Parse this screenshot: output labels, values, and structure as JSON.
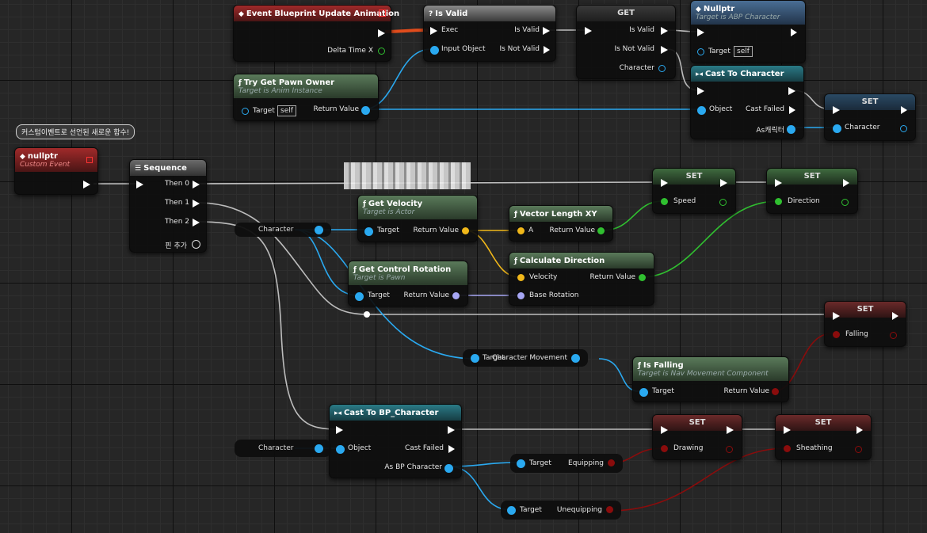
{
  "colors": {
    "exec": "#ffffff",
    "object": "#2aa9f0",
    "float": "#30c030",
    "vector": "#f1b81a",
    "rotator": "#a6a6f4",
    "bool": "#8a0c0c",
    "event": "#a02a2a",
    "pure": "#5a7a5a",
    "cast": "#2a7a86"
  },
  "nodes": {
    "event_update": {
      "title": "Event Blueprint Update Animation",
      "delta": "Delta Time X"
    },
    "is_valid": {
      "title": "Is Valid",
      "exec": "Exec",
      "input": "Input Object",
      "is_valid": "Is Valid",
      "not_valid": "Is Not Valid"
    },
    "get": {
      "title": "GET",
      "is_valid": "Is Valid",
      "not_valid": "Is Not Valid",
      "character": "Character"
    },
    "nullptr_top": {
      "title": "Nullptr",
      "subtitle": "Target is ABP Character",
      "target": "Target",
      "target_val": "self"
    },
    "try_get_pawn": {
      "title": "Try Get Pawn Owner",
      "subtitle": "Target is Anim Instance",
      "target": "Target",
      "target_val": "self",
      "ret": "Return Value"
    },
    "cast_character": {
      "title": "Cast To Character",
      "object": "Object",
      "failed": "Cast Failed",
      "as": "As캐릭터"
    },
    "set_character": {
      "title": "SET",
      "character": "Character"
    },
    "comment": {
      "text": "커스텀이벤트로 선언된 새로운 함수!"
    },
    "custom_event": {
      "title": "nullptr",
      "subtitle": "Custom Event"
    },
    "sequence": {
      "title": "Sequence",
      "then0": "Then 0",
      "then1": "Then 1",
      "then2": "Then 2",
      "add": "핀 추가"
    },
    "char_ref1": {
      "label": "Character"
    },
    "get_velocity": {
      "title": "Get Velocity",
      "subtitle": "Target is Actor",
      "target": "Target",
      "ret": "Return Value"
    },
    "vector_length": {
      "title": "Vector Length XY",
      "a": "A",
      "ret": "Return Value"
    },
    "set_speed": {
      "title": "SET",
      "speed": "Speed"
    },
    "set_direction": {
      "title": "SET",
      "direction": "Direction"
    },
    "get_control_rot": {
      "title": "Get Control Rotation",
      "subtitle": "Target is Pawn",
      "target": "Target",
      "ret": "Return Value"
    },
    "calc_direction": {
      "title": "Calculate Direction",
      "velocity": "Velocity",
      "base_rot": "Base Rotation",
      "ret": "Return Value"
    },
    "set_falling": {
      "title": "SET",
      "falling": "Falling"
    },
    "char_movement": {
      "target": "Target",
      "label": "Character Movement"
    },
    "is_falling": {
      "title": "Is Falling",
      "subtitle": "Target is Nav Movement Component",
      "target": "Target",
      "ret": "Return Value"
    },
    "cast_bp": {
      "title": "Cast To BP_Character",
      "object": "Object",
      "failed": "Cast Failed",
      "as": "As BP Character"
    },
    "char_ref2": {
      "label": "Character"
    },
    "equipping": {
      "target": "Target",
      "label": "Equipping"
    },
    "unequipping": {
      "target": "Target",
      "label": "Unequipping"
    },
    "set_drawing": {
      "title": "SET",
      "drawing": "Drawing"
    },
    "set_sheathing": {
      "title": "SET",
      "sheathing": "Sheathing"
    }
  }
}
